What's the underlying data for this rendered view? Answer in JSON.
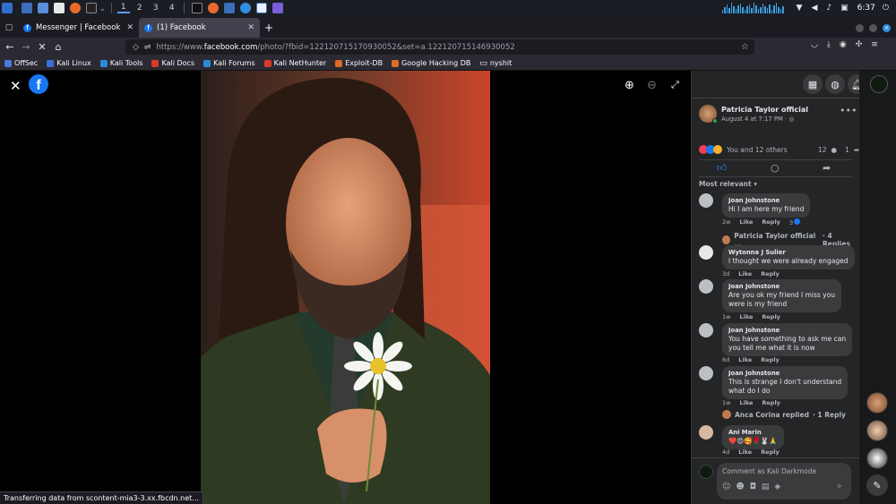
{
  "system": {
    "workspaces": [
      "1",
      "2",
      "3",
      "4"
    ],
    "clock": "6:37",
    "colors": {
      "bar": "#1a1d23",
      "accent": "#3aa0e0"
    }
  },
  "browser": {
    "tabs": [
      {
        "label": "Messenger | Facebook",
        "active": false,
        "icon": "facebook-icon"
      },
      {
        "label": "(1) Facebook",
        "active": true,
        "icon": "facebook-icon"
      }
    ],
    "new_tab": "+",
    "url_prefix": "https://www.",
    "url_domain": "facebook.com",
    "url_rest": "/photo/?fbid=122120715170930052&set=a.122120715146930052",
    "bookmarks": [
      {
        "label": "OffSec",
        "color": "#4a7bd8"
      },
      {
        "label": "Kali Linux",
        "color": "#3b6fd6"
      },
      {
        "label": "Kali Tools",
        "color": "#2a8cd9"
      },
      {
        "label": "Kali Docs",
        "color": "#d93a2a"
      },
      {
        "label": "Kali Forums",
        "color": "#2a8cd9"
      },
      {
        "label": "Kali NetHunter",
        "color": "#d93a2a"
      },
      {
        "label": "Exploit-DB",
        "color": "#e06a2a"
      },
      {
        "label": "Google Hacking DB",
        "color": "#e06a2a"
      },
      {
        "label": "nyshit",
        "color": "#cccccc"
      }
    ],
    "status_text": "Transferring data from scontent-mia3-3.xx.fbcdn.net..."
  },
  "post": {
    "author": "Patricia Taylor official",
    "date": "August 4 at 7:17 PM",
    "date_suffix": "·",
    "reactions_text": "You and 12 others",
    "comment_count": "12",
    "share_count": "1",
    "sort_label": "Most relevant"
  },
  "comments": [
    {
      "name": "Joan Johnstone",
      "lines": [
        "Hi I am here my friend"
      ],
      "time": "2w",
      "like": "Like",
      "reply": "Reply",
      "react_count": "3"
    },
    {
      "name": "Wytonna J Sulier",
      "lines": [
        "I thought we were already engaged"
      ],
      "time": "3d",
      "like": "Like",
      "reply": "Reply"
    },
    {
      "name": "Joan Johnstone",
      "lines": [
        "Are you ok my friend I miss you",
        "were is my friend"
      ],
      "time": "1w",
      "like": "Like",
      "reply": "Reply"
    },
    {
      "name": "Joan Johnstone",
      "lines": [
        "You have something to ask me can",
        "you tell me what it is now"
      ],
      "time": "6d",
      "like": "Like",
      "reply": "Reply"
    },
    {
      "name": "Joan Johnstone",
      "lines": [
        "This is strange I don't understand",
        "what do I do"
      ],
      "time": "1w",
      "like": "Like",
      "reply": "Reply"
    },
    {
      "name": "Ani Marin",
      "lines": [
        "❤️😍🥰🌹🐰🙏"
      ],
      "time": "4d",
      "like": "Like",
      "reply": "Reply"
    }
  ],
  "replies": [
    {
      "text": "Patricia Taylor official ...",
      "suffix": "· 4 Replies"
    },
    {
      "text": "Anca Corina replied",
      "suffix": "· 1 Reply"
    }
  ],
  "composer": {
    "placeholder": "Comment as Kali Darkmode"
  },
  "notifications_badge": "1"
}
